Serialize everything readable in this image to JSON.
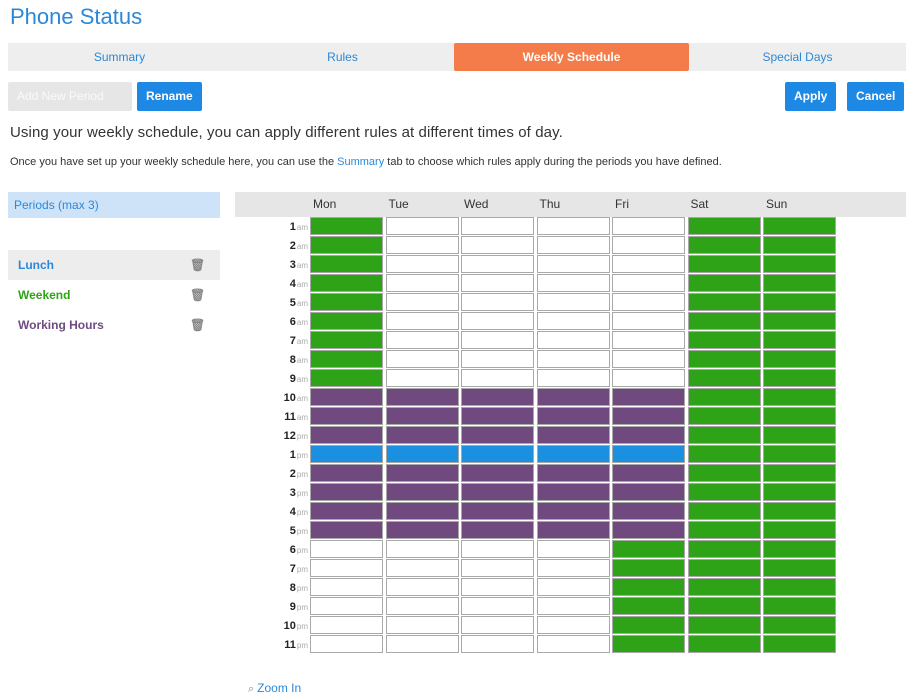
{
  "title": "Phone Status",
  "tabs": [
    {
      "label": "Summary"
    },
    {
      "label": "Rules"
    },
    {
      "label": "Weekly Schedule"
    },
    {
      "label": "Special Days"
    }
  ],
  "toolbar": {
    "add_label": "Add New Period",
    "rename_label": "Rename",
    "apply_label": "Apply",
    "cancel_label": "Cancel"
  },
  "intro": {
    "headline": "Using your weekly schedule, you can apply different rules at different times of day.",
    "sub_before": "Once you have set up your weekly schedule here, you can use the ",
    "sub_link": "Summary",
    "sub_after": " tab to choose which rules apply during the periods you have defined."
  },
  "periods": {
    "header": "Periods (max 3)",
    "items": [
      {
        "label": "Lunch",
        "color": "#2b88d8"
      },
      {
        "label": "Weekend",
        "color": "#2fa318"
      },
      {
        "label": "Working Hours",
        "color": "#6f4b7f"
      }
    ]
  },
  "schedule": {
    "days": [
      "Mon",
      "Tue",
      "Wed",
      "Thu",
      "Fri",
      "Sat",
      "Sun"
    ],
    "hours": [
      {
        "n": "1",
        "p": "am"
      },
      {
        "n": "2",
        "p": "am"
      },
      {
        "n": "3",
        "p": "am"
      },
      {
        "n": "4",
        "p": "am"
      },
      {
        "n": "5",
        "p": "am"
      },
      {
        "n": "6",
        "p": "am"
      },
      {
        "n": "7",
        "p": "am"
      },
      {
        "n": "8",
        "p": "am"
      },
      {
        "n": "9",
        "p": "am"
      },
      {
        "n": "10",
        "p": "am"
      },
      {
        "n": "11",
        "p": "am"
      },
      {
        "n": "12",
        "p": "pm"
      },
      {
        "n": "1",
        "p": "pm"
      },
      {
        "n": "2",
        "p": "pm"
      },
      {
        "n": "3",
        "p": "pm"
      },
      {
        "n": "4",
        "p": "pm"
      },
      {
        "n": "5",
        "p": "pm"
      },
      {
        "n": "6",
        "p": "pm"
      },
      {
        "n": "7",
        "p": "pm"
      },
      {
        "n": "8",
        "p": "pm"
      },
      {
        "n": "9",
        "p": "pm"
      },
      {
        "n": "10",
        "p": "pm"
      },
      {
        "n": "11",
        "p": "pm"
      }
    ],
    "colors": {
      "none": "#ffffff",
      "Weekend": "#2fa318",
      "Working Hours": "#704a7e",
      "Lunch": "#1c90e0"
    },
    "grid": [
      [
        "Weekend",
        "",
        "",
        "",
        "",
        "Weekend",
        "Weekend"
      ],
      [
        "Weekend",
        "",
        "",
        "",
        "",
        "Weekend",
        "Weekend"
      ],
      [
        "Weekend",
        "",
        "",
        "",
        "",
        "Weekend",
        "Weekend"
      ],
      [
        "Weekend",
        "",
        "",
        "",
        "",
        "Weekend",
        "Weekend"
      ],
      [
        "Weekend",
        "",
        "",
        "",
        "",
        "Weekend",
        "Weekend"
      ],
      [
        "Weekend",
        "",
        "",
        "",
        "",
        "Weekend",
        "Weekend"
      ],
      [
        "Weekend",
        "",
        "",
        "",
        "",
        "Weekend",
        "Weekend"
      ],
      [
        "Weekend",
        "",
        "",
        "",
        "",
        "Weekend",
        "Weekend"
      ],
      [
        "Weekend",
        "",
        "",
        "",
        "",
        "Weekend",
        "Weekend"
      ],
      [
        "Working Hours",
        "Working Hours",
        "Working Hours",
        "Working Hours",
        "Working Hours",
        "Weekend",
        "Weekend"
      ],
      [
        "Working Hours",
        "Working Hours",
        "Working Hours",
        "Working Hours",
        "Working Hours",
        "Weekend",
        "Weekend"
      ],
      [
        "Working Hours",
        "Working Hours",
        "Working Hours",
        "Working Hours",
        "Working Hours",
        "Weekend",
        "Weekend"
      ],
      [
        "Lunch",
        "Lunch",
        "Lunch",
        "Lunch",
        "Lunch",
        "Weekend",
        "Weekend"
      ],
      [
        "Working Hours",
        "Working Hours",
        "Working Hours",
        "Working Hours",
        "Working Hours",
        "Weekend",
        "Weekend"
      ],
      [
        "Working Hours",
        "Working Hours",
        "Working Hours",
        "Working Hours",
        "Working Hours",
        "Weekend",
        "Weekend"
      ],
      [
        "Working Hours",
        "Working Hours",
        "Working Hours",
        "Working Hours",
        "Working Hours",
        "Weekend",
        "Weekend"
      ],
      [
        "Working Hours",
        "Working Hours",
        "Working Hours",
        "Working Hours",
        "Working Hours",
        "Weekend",
        "Weekend"
      ],
      [
        "",
        "",
        "",
        "",
        "Weekend",
        "Weekend",
        "Weekend"
      ],
      [
        "",
        "",
        "",
        "",
        "Weekend",
        "Weekend",
        "Weekend"
      ],
      [
        "",
        "",
        "",
        "",
        "Weekend",
        "Weekend",
        "Weekend"
      ],
      [
        "",
        "",
        "",
        "",
        "Weekend",
        "Weekend",
        "Weekend"
      ],
      [
        "",
        "",
        "",
        "",
        "Weekend",
        "Weekend",
        "Weekend"
      ],
      [
        "",
        "",
        "",
        "",
        "Weekend",
        "Weekend",
        "Weekend"
      ]
    ]
  },
  "zoom": {
    "label": "Zoom In",
    "icon": "zoom-in-icon"
  }
}
